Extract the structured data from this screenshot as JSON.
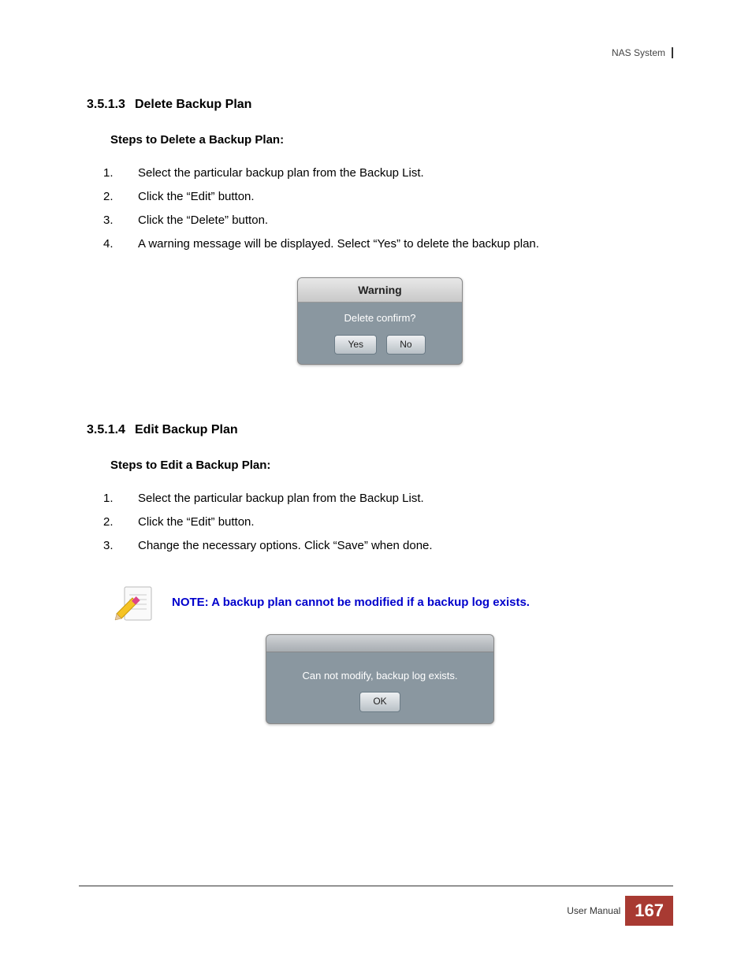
{
  "header": {
    "product": "NAS System"
  },
  "section1": {
    "number": "3.5.1.3",
    "title": "Delete Backup Plan",
    "sub": "Steps to Delete a Backup Plan:",
    "steps": [
      "Select the particular backup plan from the Backup List.",
      "Click the “Edit” button.",
      "Click the “Delete” button.",
      "A warning message will be displayed. Select “Yes” to delete the backup plan."
    ],
    "dialog": {
      "title": "Warning",
      "message": "Delete confirm?",
      "yes": "Yes",
      "no": "No"
    }
  },
  "section2": {
    "number": "3.5.1.4",
    "title": "Edit Backup Plan",
    "sub": "Steps to Edit a Backup Plan:",
    "steps": [
      "Select the particular backup plan from the Backup List.",
      "Click the “Edit” button.",
      "Change the necessary options. Click “Save” when done."
    ],
    "note": "NOTE: A backup plan cannot be modified if a backup log exists.",
    "dialog": {
      "message": "Can not modify, backup log exists.",
      "ok": "OK"
    }
  },
  "footer": {
    "label": "User Manual",
    "page": "167"
  }
}
